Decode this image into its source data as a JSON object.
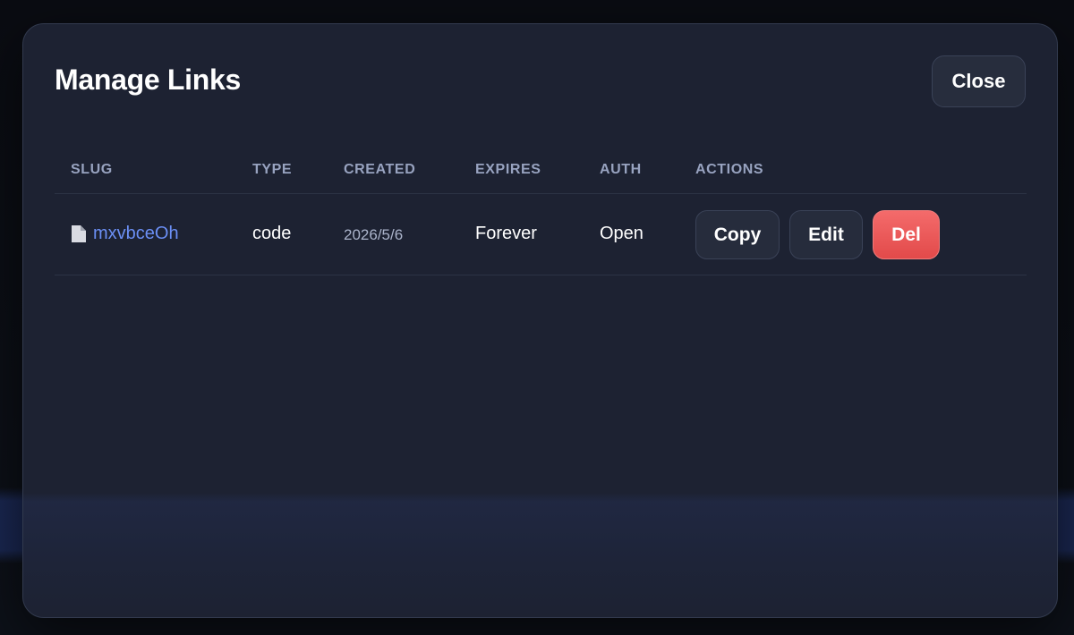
{
  "modal": {
    "title": "Manage Links",
    "close_label": "Close"
  },
  "table": {
    "headers": {
      "slug": "SLUG",
      "type": "TYPE",
      "created": "CREATED",
      "expires": "EXPIRES",
      "auth": "AUTH",
      "actions": "ACTIONS"
    },
    "rows": [
      {
        "icon": "file-icon",
        "slug": "mxvbceOh",
        "type": "code",
        "created": "2026/5/6",
        "expires": "Forever",
        "auth": "Open",
        "actions": {
          "copy": "Copy",
          "edit": "Edit",
          "delete": "Del"
        }
      }
    ]
  },
  "colors": {
    "accent_link": "#6b8ff5",
    "danger": "#e24a4a",
    "modal_bg": "#1d2232"
  }
}
